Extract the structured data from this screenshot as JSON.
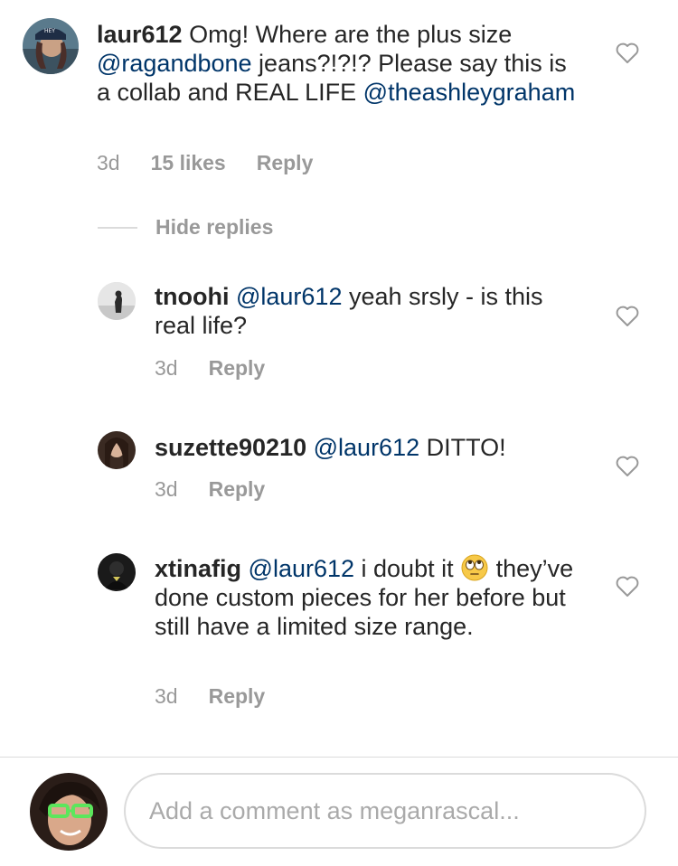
{
  "comments": [
    {
      "username": "laur612",
      "segments": [
        {
          "t": " Omg! Where are the plus size "
        },
        {
          "m": "@ragandbone"
        },
        {
          "t": " jeans?!?!? Please say this is a collab and REAL LIFE "
        },
        {
          "m": "@theashleygraham"
        }
      ],
      "time": "3d",
      "likes": "15 likes",
      "reply": "Reply"
    }
  ],
  "hide_replies": "Hide replies",
  "replies": [
    {
      "username": "tnoohi",
      "mention": "@laur612",
      "text": " yeah srsly - is this real life?",
      "time": "3d",
      "reply": "Reply"
    },
    {
      "username": "suzette90210",
      "mention": "@laur612",
      "text": " DITTO!",
      "time": "3d",
      "reply": "Reply"
    },
    {
      "username": "xtinafig",
      "mention": "@laur612",
      "text_before_emoji": " i doubt it ",
      "emoji": "face-with-rolling-eyes",
      "text_after_emoji": " they’ve done custom pieces for her before but still have a limited size range.",
      "time": "3d",
      "reply": "Reply"
    }
  ],
  "composer": {
    "placeholder": "Add a comment as meganrascal..."
  },
  "colors": {
    "mention": "#003569",
    "meta": "#999999",
    "divider": "#dbdbdb"
  }
}
